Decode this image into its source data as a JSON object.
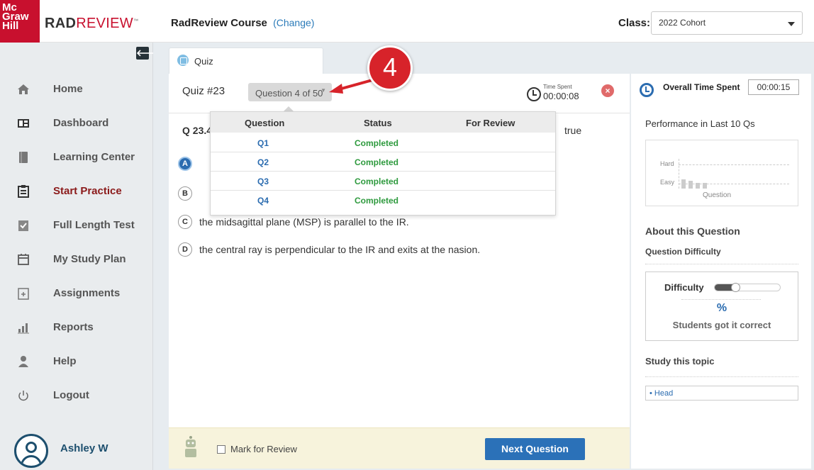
{
  "header": {
    "logo_text": [
      "Mc",
      "Graw",
      "Hill"
    ],
    "brand_bold": "RAD",
    "brand_light": "REVIEW",
    "brand_tm": "™",
    "course_title": "RadReview Course",
    "change_link": "(Change)",
    "class_label": "Class:",
    "class_value": "2022 Cohort"
  },
  "sidebar": {
    "collapse_glyph": "🡐",
    "items": [
      {
        "label": "Home",
        "icon": "home-icon"
      },
      {
        "label": "Dashboard",
        "icon": "dashboard-icon"
      },
      {
        "label": "Learning Center",
        "icon": "book-icon"
      },
      {
        "label": "Start Practice",
        "icon": "clipboard-icon",
        "active": true
      },
      {
        "label": "Full Length Test",
        "icon": "check-clipboard-icon"
      },
      {
        "label": "My Study Plan",
        "icon": "calendar-icon"
      },
      {
        "label": "Assignments",
        "icon": "assignment-icon"
      },
      {
        "label": "Reports",
        "icon": "bar-chart-icon"
      },
      {
        "label": "Help",
        "icon": "help-person-icon"
      },
      {
        "label": "Logout",
        "icon": "power-icon"
      }
    ],
    "user_name": "Ashley W"
  },
  "tab": {
    "label": "Quiz"
  },
  "quiz": {
    "number": "Quiz #23",
    "question_selector": "Question 4 of 50",
    "time_caption": "Time Spent",
    "time_value": "00:00:08",
    "question_prefix": "Q 23.4",
    "question_tail": "true",
    "choices": [
      {
        "letter": "A",
        "text": "",
        "selected": true
      },
      {
        "letter": "B",
        "text": ""
      },
      {
        "letter": "C",
        "text": "the midsagittal plane (MSP) is parallel to the IR."
      },
      {
        "letter": "D",
        "text": "the central ray is perpendicular to the IR and exits at the nasion."
      }
    ]
  },
  "question_list": {
    "headers": [
      "Question",
      "Status",
      "For Review"
    ],
    "rows": [
      {
        "q": "Q1",
        "status": "Completed"
      },
      {
        "q": "Q2",
        "status": "Completed"
      },
      {
        "q": "Q3",
        "status": "Completed"
      },
      {
        "q": "Q4",
        "status": "Completed"
      }
    ]
  },
  "annotation": {
    "number": "4",
    "color": "#d7232a"
  },
  "footer": {
    "mark_label": "Mark for Review",
    "next_label": "Next Question"
  },
  "right_panel": {
    "overall_label": "Overall Time Spent",
    "overall_value": "00:00:15",
    "perf_title": "Performance in Last 10 Qs",
    "perf_hard": "Hard",
    "perf_easy": "Easy",
    "perf_xlabel": "Question",
    "about_title": "About this Question",
    "difficulty_title": "Question Difficulty",
    "difficulty_label": "Difficulty",
    "difficulty_level": 0.25,
    "percent": "%",
    "percent_sub": "Students got it correct",
    "study_title": "Study this topic",
    "topic": "• Head"
  },
  "colors": {
    "brand_red": "#c8102e",
    "link_blue": "#2b6cb0",
    "completed_green": "#2e9a3e",
    "button_blue": "#2b71b8"
  }
}
